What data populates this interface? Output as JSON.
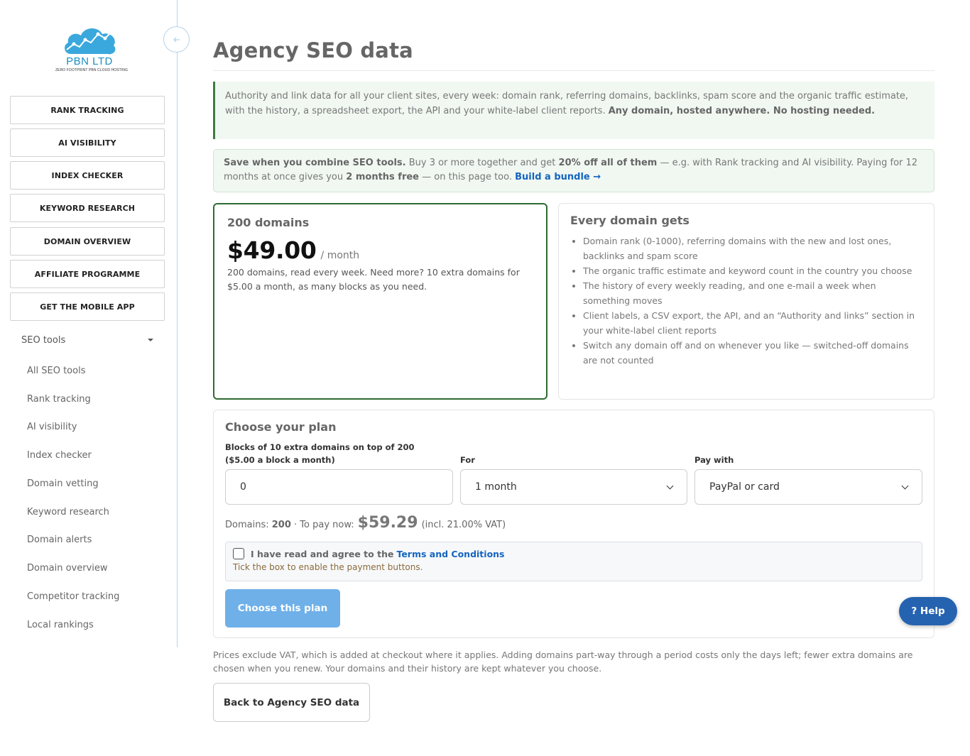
{
  "brand": {
    "name": "PBN LTD",
    "tagline": "ZERO FOOTPRINT PBN CLOUD HOSTING",
    "accent": "#1a8fc4"
  },
  "sidebar": {
    "collapse_icon": "arrow-left-icon",
    "buttons": [
      {
        "label": "RANK TRACKING"
      },
      {
        "label": "AI VISIBILITY"
      },
      {
        "label": "INDEX CHECKER"
      },
      {
        "label": "KEYWORD RESEARCH"
      },
      {
        "label": "DOMAIN OVERVIEW"
      },
      {
        "label": "AFFILIATE PROGRAMME"
      },
      {
        "label": "GET THE MOBILE APP"
      }
    ],
    "tools_header": "SEO tools",
    "tools": [
      {
        "label": "All SEO tools"
      },
      {
        "label": "Rank tracking"
      },
      {
        "label": "AI visibility"
      },
      {
        "label": "Index checker"
      },
      {
        "label": "Domain vetting"
      },
      {
        "label": "Keyword research"
      },
      {
        "label": "Domain alerts"
      },
      {
        "label": "Domain overview"
      },
      {
        "label": "Competitor tracking"
      },
      {
        "label": "Local rankings"
      }
    ]
  },
  "page": {
    "title": "Agency SEO data",
    "intro_text": "Authority and link data for all your client sites, every week: domain rank, referring domains, backlinks, spam score and the organic traffic estimate, with the history, a spreadsheet export, the API and your white-label client reports.",
    "intro_bold": "Any domain, hosted anywhere. No hosting needed.",
    "bundle": {
      "lead": "Save when you combine SEO tools.",
      "text1": "Buy 3 or more together and get",
      "bold1": "20% off all of them",
      "text2": "— e.g. with Rank tracking and AI visibility. Paying for 12 months at once gives you",
      "bold2": "2 months free",
      "text3": "— on this page too.",
      "link": "Build a bundle →"
    }
  },
  "plan": {
    "name": "200 domains",
    "price": "$49.00",
    "period": "/ month",
    "description": "200 domains, read every week. Need more? 10 extra domains for $5.00 a month, as many blocks as you need."
  },
  "features": {
    "title": "Every domain gets",
    "items": [
      "Domain rank (0-1000), referring domains with the new and lost ones, backlinks and spam score",
      "The organic traffic estimate and keyword count in the country you choose",
      "The history of every weekly reading, and one e-mail a week when something moves",
      "Client labels, a CSV export, the API, and an “Authority and links” section in your white-label client reports",
      "Switch any domain off and on whenever you like — switched-off domains are not counted"
    ]
  },
  "choose": {
    "title": "Choose your plan",
    "blocks_label": "Blocks of 10 extra domains on top of 200 ($5.00 a block a month)",
    "blocks_value": "0",
    "for_label": "For",
    "for_value": "1 month",
    "pay_label": "Pay with",
    "pay_value": "PayPal or card",
    "domains_prefix": "Domains:",
    "domains_count": "200",
    "pay_prefix": "· To pay now:",
    "total": "$59.29",
    "vat_note": "(incl. 21.00% VAT)",
    "terms_text": "I have read and agree to the",
    "terms_link": "Terms and Conditions",
    "terms_hint": "Tick the box to enable the payment buttons.",
    "submit_label": "Choose this plan"
  },
  "footer": {
    "note": "Prices exclude VAT, which is added at checkout where it applies. Adding domains part-way through a period costs only the days left; fewer extra domains are chosen when you renew. Your domains and their history are kept whatever you choose.",
    "back_label": "Back to Agency SEO data"
  },
  "help": {
    "label": "? Help"
  },
  "colors": {
    "plan_border": "#2e6b32",
    "link": "#1565c0",
    "primary_button": "#6fb0e8",
    "help_button": "#2563b0"
  }
}
